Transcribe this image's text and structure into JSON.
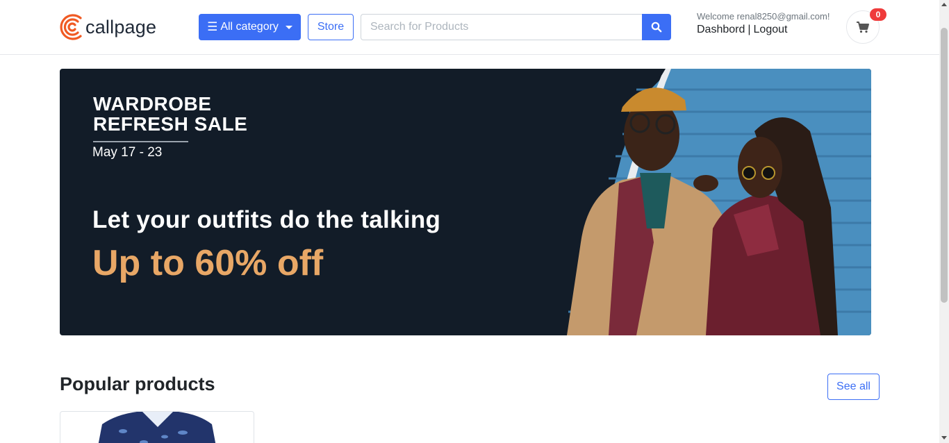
{
  "brand": {
    "name": "callpage",
    "logo_icon": "callpage-logo-icon",
    "accent": "#f05a23"
  },
  "header": {
    "category_label": "All category",
    "store_label": "Store",
    "search_placeholder": "Search for Products",
    "search_value": "",
    "welcome": "Welcome renal8250@gmail.com!",
    "dashboard_label": "Dashbord",
    "separator": "|",
    "logout_label": "Logout",
    "cart_count": "0"
  },
  "banner": {
    "title_line1": "WARDROBE",
    "title_line2": "REFRESH SALE",
    "date": "May 17 - 23",
    "tagline": "Let your outfits do the talking",
    "offer": "Up to 60% off",
    "offer_color": "#e8a766",
    "background": "#121c28"
  },
  "popular": {
    "title": "Popular products",
    "see_all_label": "See all"
  },
  "colors": {
    "primary": "#3b6ef5",
    "badge": "#ef3b3b"
  }
}
